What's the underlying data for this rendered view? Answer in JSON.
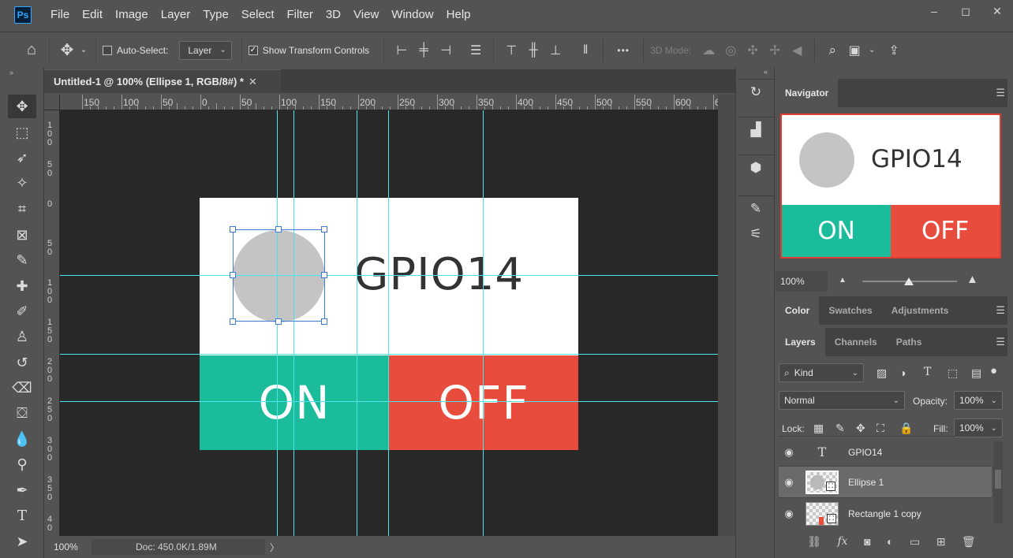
{
  "app": {
    "logo": "Ps",
    "menu": [
      "File",
      "Edit",
      "Image",
      "Layer",
      "Type",
      "Select",
      "Filter",
      "3D",
      "View",
      "Window",
      "Help"
    ],
    "window_controls": {
      "minimize": "‒",
      "restore": "◻",
      "close": "✕"
    }
  },
  "options": {
    "auto_select_label": "Auto-Select:",
    "auto_select_checked": false,
    "auto_select_target": "Layer",
    "show_transform_label": "Show Transform Controls",
    "show_transform_checked": true,
    "more": "•••",
    "mode_3d_label": "3D Mode:"
  },
  "document": {
    "tab_title": "Untitled-1 @ 100% (Ellipse 1, RGB/8#) *",
    "close": "✕",
    "ruler_h": [
      "150",
      "100",
      "50",
      "0",
      "50",
      "100",
      "150",
      "200",
      "250",
      "300",
      "350",
      "400",
      "450",
      "500",
      "550",
      "600",
      "6"
    ],
    "ruler_v": [
      "100",
      "50",
      "0",
      "50",
      "100",
      "150",
      "200",
      "250",
      "300",
      "350",
      "40"
    ],
    "artwork": {
      "label": "GPIO14",
      "on_label": "ON",
      "off_label": "OFF",
      "colors": {
        "on": "#1abc9c",
        "off": "#e74c3c",
        "ellipse": "#c4c4c4",
        "background": "#ffffff"
      }
    }
  },
  "status": {
    "zoom": "100%",
    "doc_size": "Doc: 450.0K/1.89M",
    "arrow": "〉"
  },
  "navigator": {
    "tab": "Navigator",
    "zoom": "100%",
    "preview": {
      "label": "GPIO14",
      "on_label": "ON",
      "off_label": "OFF"
    }
  },
  "color_panel": {
    "tabs": [
      "Color",
      "Swatches",
      "Adjustments"
    ]
  },
  "layers_panel": {
    "tabs": [
      "Layers",
      "Channels",
      "Paths"
    ],
    "filter_kind": "Kind",
    "blend_mode": "Normal",
    "opacity_label": "Opacity:",
    "opacity_value": "100%",
    "lock_label": "Lock:",
    "fill_label": "Fill:",
    "fill_value": "100%",
    "layers": [
      {
        "name": "GPIO14",
        "kind": "type",
        "selected": false
      },
      {
        "name": "Ellipse 1",
        "kind": "shape",
        "selected": true
      },
      {
        "name": "Rectangle 1 copy",
        "kind": "shape",
        "selected": false
      }
    ]
  }
}
